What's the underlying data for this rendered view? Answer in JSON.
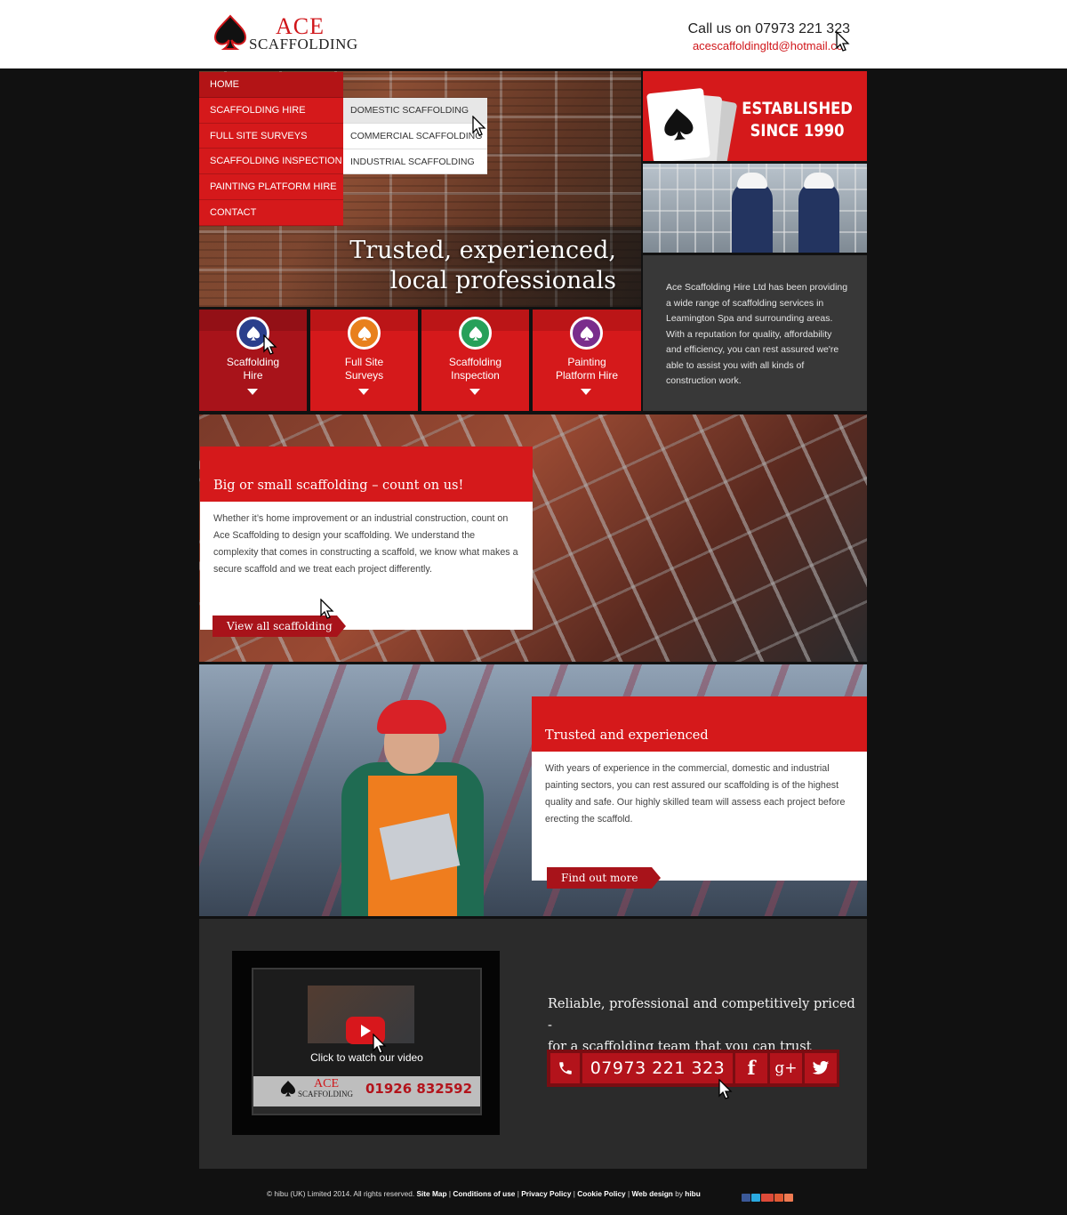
{
  "header": {
    "logo_top": "ACE",
    "logo_bottom": "SCAFFOLDING",
    "call": "Call us on 07973 221 323",
    "email": "acescaffoldingltd@hotmail.co"
  },
  "nav": {
    "items": [
      "HOME",
      "SCAFFOLDING HIRE",
      "FULL SITE SURVEYS",
      "SCAFFOLDING INSPECTION",
      "PAINTING PLATFORM HIRE",
      "CONTACT"
    ],
    "submenu": [
      "DOMESTIC SCAFFOLDING",
      "COMMERCIAL SCAFFOLDING",
      "INDUSTRIAL SCAFFOLDING"
    ]
  },
  "hero": {
    "line1": "Trusted, experienced,",
    "line2": "local professionals"
  },
  "established": {
    "line1": "ESTABLISHED",
    "line2": "SINCE 1990"
  },
  "about": "Ace Scaffolding Hire Ltd has been providing a wide range of scaffolding services in Leamington Spa and surrounding areas. With a reputation for quality, affordability and efficiency, you can rest assured we're able to assist you with all kinds of construction work.",
  "tiles": [
    {
      "line1": "Scaffolding",
      "line2": "Hire",
      "color": "#2b3f8c"
    },
    {
      "line1": "Full Site",
      "line2": "Surveys",
      "color": "#e8801c"
    },
    {
      "line1": "Scaffolding",
      "line2": "Inspection",
      "color": "#27a05a"
    },
    {
      "line1": "Painting",
      "line2": "Platform Hire",
      "color": "#7a2d8c"
    }
  ],
  "section_big": {
    "title": "Big or small scaffolding – count on us!",
    "body": "Whether it’s home improvement or an industrial construction, count on Ace Scaffolding to design your scaffolding. We understand the complexity that comes in constructing a scaffold, we know what makes a secure scaffold and we treat each project differently.",
    "button": "View all scaffolding"
  },
  "section_trusted": {
    "title": "Trusted and experienced",
    "body": "With years of experience in the commercial, domestic and industrial painting sectors, you can rest assured our scaffolding is of the highest quality and safe. Our highly skilled team will assess each project before erecting the scaffold.",
    "button": "Find out more"
  },
  "video": {
    "caption": "Click to watch our video",
    "bar_ace": "ACE",
    "bar_scaffolding": "SCAFFOLDING",
    "bar_phone": "01926 832592"
  },
  "slogan": {
    "line1": "Reliable, professional and competitively priced -",
    "line2": "for a scaffolding team that you can trust"
  },
  "contact": {
    "phone": "07973 221 323",
    "facebook": "f",
    "googleplus": "g+"
  },
  "footer": {
    "copyright": "© hibu (UK) Limited 2014. All rights reserved.",
    "links": [
      "Site Map",
      "Conditions of use",
      "Privacy Policy",
      "Cookie Policy",
      "Web design"
    ],
    "by": "by",
    "hibu": "hibu",
    "separator": "|"
  },
  "colors": {
    "brand_red": "#d5191b",
    "dark_red": "#a8131a",
    "page_bg": "#111111",
    "panel_dark": "#383838"
  }
}
